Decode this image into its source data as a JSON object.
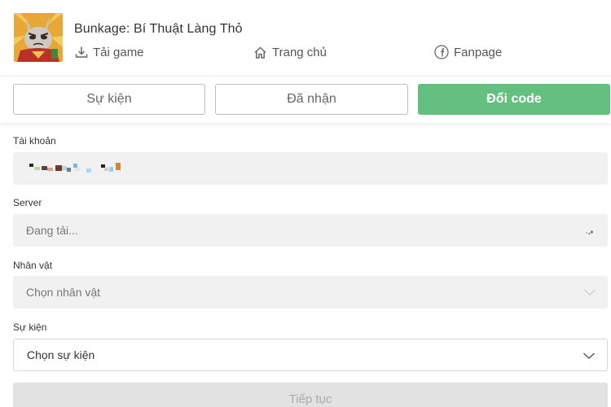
{
  "header": {
    "game_title": "Bunkage: Bí Thuật Làng Thỏ",
    "links": {
      "download": "Tải game",
      "home": "Trang chủ",
      "fanpage": "Fanpage"
    }
  },
  "tabs": {
    "events": "Sự kiện",
    "received": "Đã nhận",
    "redeem": "Đổi code"
  },
  "form": {
    "account": {
      "label": "Tài khoản",
      "value": ""
    },
    "server": {
      "label": "Server",
      "value": "Đang tải..."
    },
    "character": {
      "label": "Nhân vật",
      "placeholder": "Chọn nhân vật"
    },
    "event": {
      "label": "Sự kiện",
      "placeholder": "Chọn sự kiện"
    }
  },
  "continue_label": "Tiếp tục",
  "colors": {
    "accent": "#63c07f",
    "disabled_bg": "#f1f1f1"
  },
  "icons": [
    "game-avatar",
    "download-icon",
    "home-icon",
    "facebook-icon",
    "chevron-down-icon",
    "loading-spinner-icon"
  ]
}
